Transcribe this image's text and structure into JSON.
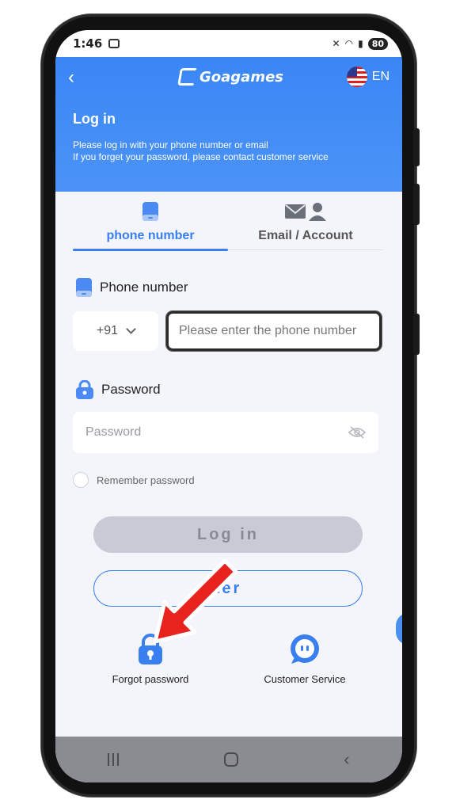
{
  "status": {
    "time": "1:46",
    "battery": "80"
  },
  "header": {
    "brand": "Goagames",
    "language": "EN",
    "title": "Log in",
    "subtitle_line1": "Please log in with your phone number or email",
    "subtitle_line2": "If you forget your password, please contact customer service",
    "accent_color": "#3a86f5"
  },
  "tabs": [
    {
      "label": "phone number",
      "active": true,
      "icon": "phone-icon"
    },
    {
      "label": "Email / Account",
      "active": false,
      "icon": "email-account-icon"
    }
  ],
  "form": {
    "phone_label": "Phone number",
    "country_code": "+91",
    "phone_placeholder": "Please enter the phone number",
    "password_label": "Password",
    "password_placeholder": "Password",
    "remember_label": "Remember password"
  },
  "buttons": {
    "login": "Log in",
    "register": "ter"
  },
  "links": {
    "forgot": "Forgot password",
    "service": "Customer Service"
  }
}
